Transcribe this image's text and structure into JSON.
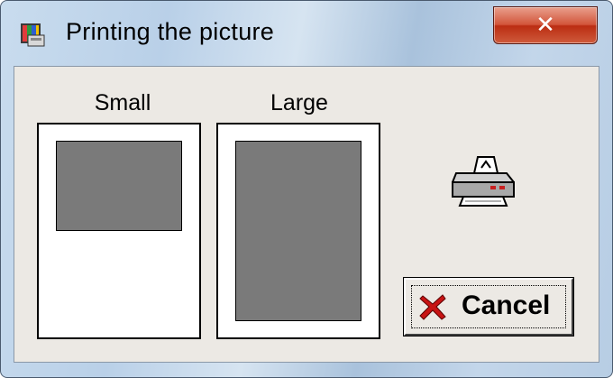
{
  "window": {
    "title": "Printing the picture",
    "close_symbol": "✕",
    "app_icon": "paint-palette-icon"
  },
  "previews": {
    "small_label": "Small",
    "large_label": "Large"
  },
  "printer_icon": "printer-icon",
  "buttons": {
    "cancel_label": "Cancel",
    "cancel_icon": "red-x-icon"
  },
  "colors": {
    "picture_fill": "#7a7a7a",
    "close_button": "#c8452a",
    "cancel_x": "#c81414"
  }
}
